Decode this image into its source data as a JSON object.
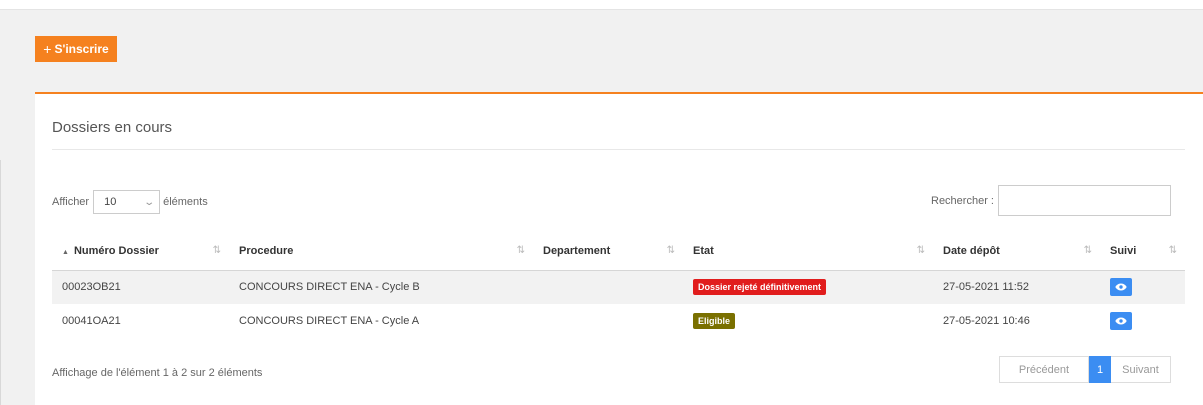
{
  "actions": {
    "add_plus": "+",
    "add_label": "S'inscrire"
  },
  "panel": {
    "title": "Dossiers en cours",
    "length_prefix": "Afficher",
    "length_value": "10",
    "length_suffix": "éléments",
    "search_label": "Rechercher :",
    "search_value": ""
  },
  "table": {
    "columns": [
      "Numéro Dossier",
      "Procedure",
      "Departement",
      "Etat",
      "Date dépôt",
      "Suivi"
    ],
    "sorted_column": "Numéro Dossier",
    "rows": [
      {
        "numero": "00023OB21",
        "procedure": "CONCOURS DIRECT ENA - Cycle B",
        "departement": "",
        "etat": "Dossier rejeté définitivement",
        "etat_color": "#e11d1d",
        "date": "27-05-2021 11:52",
        "suivi_icon": "eye-icon"
      },
      {
        "numero": "00041OA21",
        "procedure": "CONCOURS DIRECT ENA - Cycle A",
        "departement": "",
        "etat": "Eligible",
        "etat_color": "#7a7000",
        "date": "27-05-2021 10:46",
        "suivi_icon": "eye-icon"
      }
    ]
  },
  "footer": {
    "info": "Affichage de l'élément 1 à 2 sur 2 éléments",
    "prev": "Précédent",
    "page": "1",
    "next": "Suivant"
  },
  "colors": {
    "accent": "#f5811f",
    "primary": "#3b8df2"
  }
}
